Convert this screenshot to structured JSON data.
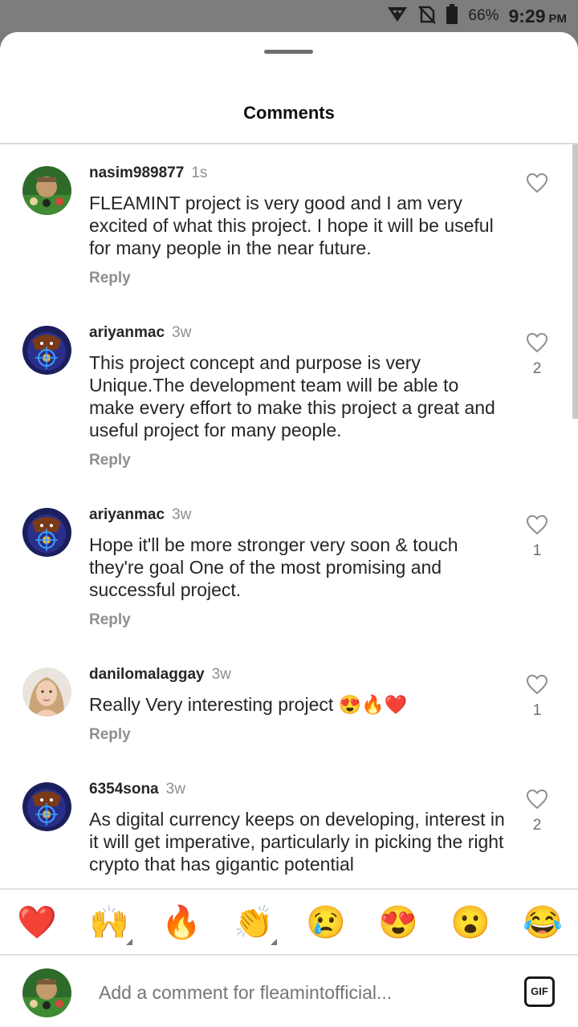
{
  "status_bar": {
    "battery": "66%",
    "time": "9:29",
    "ampm": "PM"
  },
  "header": {
    "title": "Comments"
  },
  "comments": [
    {
      "username": "nasim989877",
      "time": "1s",
      "text": "FLEAMINT project is very good and I am very excited of what this project. I hope it will be useful for many people in the near future.",
      "reply": "Reply",
      "likes": "",
      "avatar": "pool-avatar"
    },
    {
      "username": "ariyanmac",
      "time": "3w",
      "text": "This project concept and purpose  is very Unique.The development team will be able to make every effort to make this project a great and useful project for many people.",
      "reply": "Reply",
      "likes": "2",
      "avatar": "crypto-devil-avatar"
    },
    {
      "username": "ariyanmac",
      "time": "3w",
      "text": "Hope it'll be more stronger very  soon & touch they're goal One of the most promising and successful project.",
      "reply": "Reply",
      "likes": "1",
      "avatar": "crypto-devil-avatar"
    },
    {
      "username": "danilomalaggay",
      "time": "3w",
      "text": "Really Very interesting project 😍🔥❤️",
      "reply": "Reply",
      "likes": "1",
      "avatar": "woman-photo-avatar"
    },
    {
      "username": "6354sona",
      "time": "3w",
      "text": "As digital currency keeps on developing, interest in it will get imperative, particularly in picking the right crypto that has gigantic potential",
      "reply": "",
      "likes": "2",
      "avatar": "crypto-devil-avatar"
    }
  ],
  "emoji_bar": [
    "❤️",
    "🙌",
    "🔥",
    "👏",
    "😢",
    "😍",
    "😮",
    "😂"
  ],
  "composer": {
    "placeholder": "Add a comment for fleamintofficial...",
    "gif_label": "GIF"
  },
  "colors": {
    "text": "#262626",
    "muted": "#8e8e8e",
    "heart_outline": "#8e8e8e"
  }
}
